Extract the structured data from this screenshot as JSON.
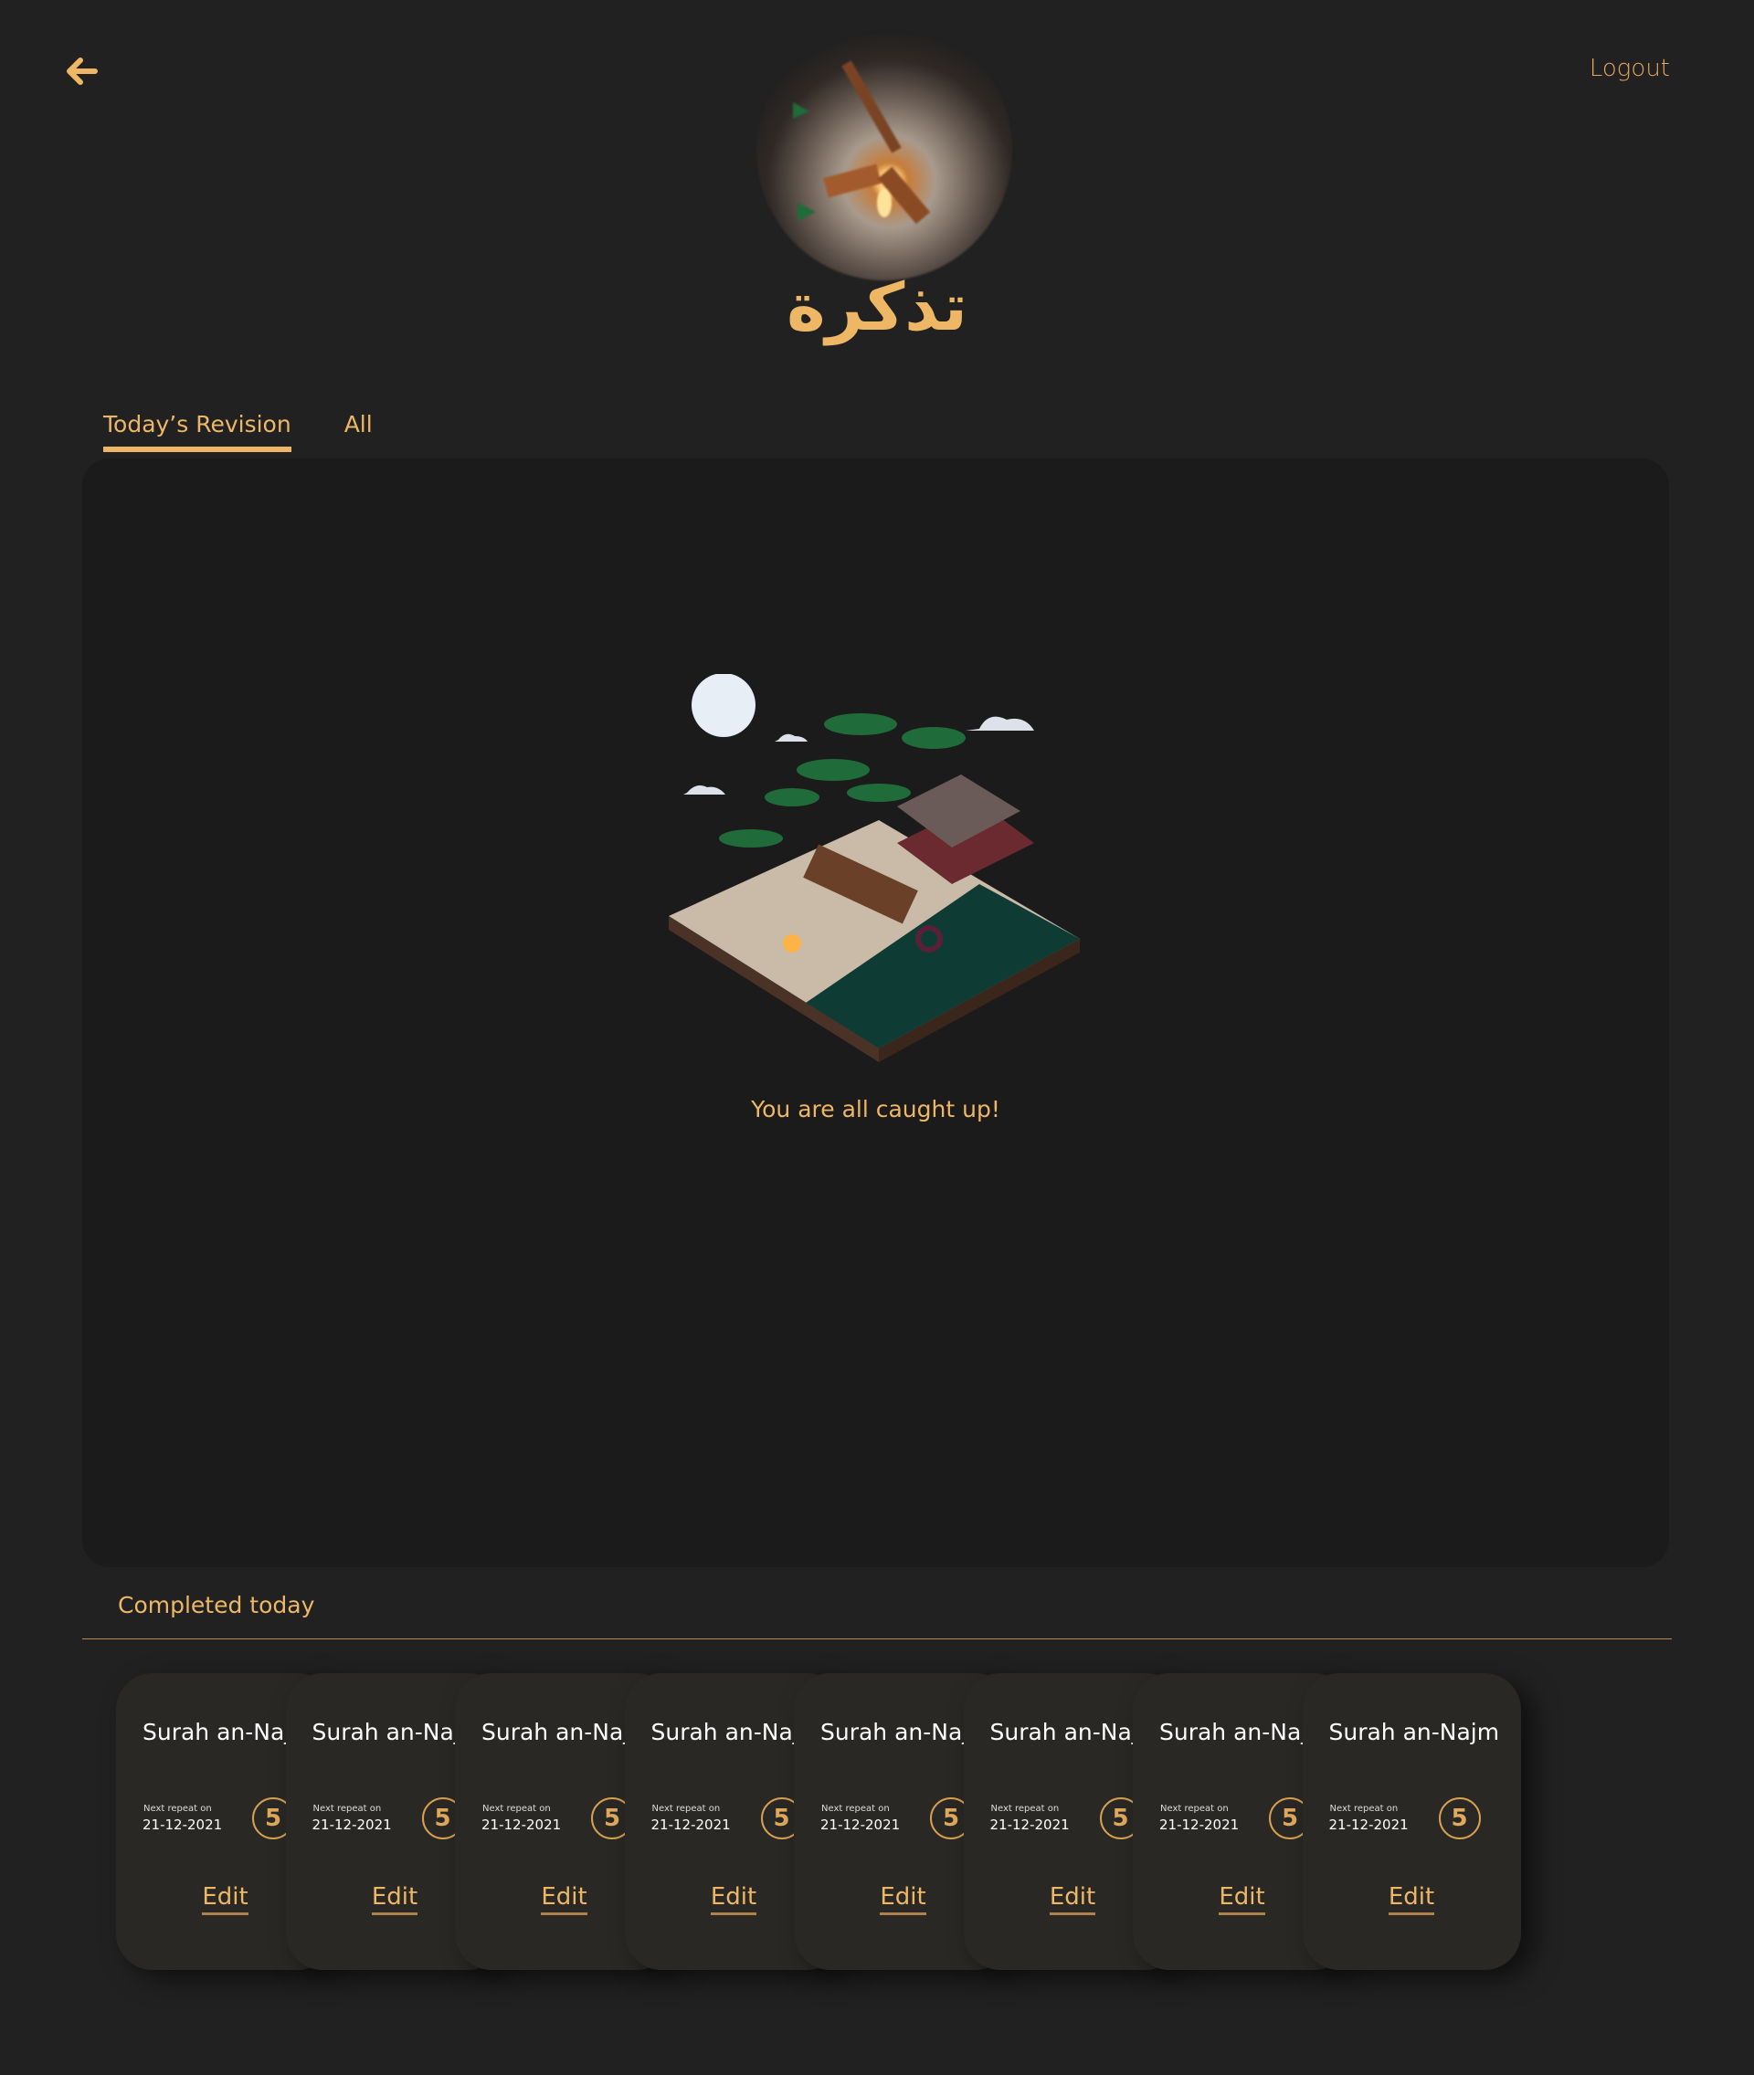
{
  "header": {
    "back_icon": "arrow-left-icon",
    "logout_label": "Logout",
    "brand_title": "تذكرة"
  },
  "tabs": [
    {
      "label": "Today’s Revision",
      "active": true
    },
    {
      "label": "All",
      "active": false
    }
  ],
  "main": {
    "empty_message": "You are all caught up!"
  },
  "completed": {
    "heading": "Completed today",
    "cards": [
      {
        "title": "Surah an-Najm",
        "next_label": "Next repeat on",
        "date": "21-12-2021",
        "count": "5",
        "edit_label": "Edit"
      },
      {
        "title": "Surah an-Najm",
        "next_label": "Next repeat on",
        "date": "21-12-2021",
        "count": "5",
        "edit_label": "Edit"
      },
      {
        "title": "Surah an-Najm",
        "next_label": "Next repeat on",
        "date": "21-12-2021",
        "count": "5",
        "edit_label": "Edit"
      },
      {
        "title": "Surah an-Najm",
        "next_label": "Next repeat on",
        "date": "21-12-2021",
        "count": "5",
        "edit_label": "Edit"
      },
      {
        "title": "Surah an-Najm",
        "next_label": "Next repeat on",
        "date": "21-12-2021",
        "count": "5",
        "edit_label": "Edit"
      },
      {
        "title": "Surah an-Najm",
        "next_label": "Next repeat on",
        "date": "21-12-2021",
        "count": "5",
        "edit_label": "Edit"
      },
      {
        "title": "Surah an-Najm",
        "next_label": "Next repeat on",
        "date": "21-12-2021",
        "count": "5",
        "edit_label": "Edit"
      },
      {
        "title": "Surah an-Najm",
        "next_label": "Next repeat on",
        "date": "21-12-2021",
        "count": "5",
        "edit_label": "Edit"
      }
    ]
  },
  "colors": {
    "accent": "#eeb766",
    "background": "#212121",
    "panel": "#1b1b1b",
    "card": "#292825"
  }
}
